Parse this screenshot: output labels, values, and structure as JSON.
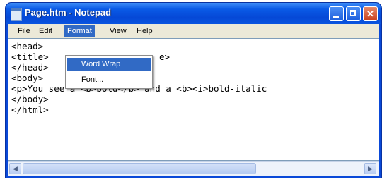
{
  "window": {
    "title": "Page.htm - Notepad"
  },
  "menubar": {
    "file": "File",
    "edit": "Edit",
    "format": "Format",
    "view": "View",
    "help": "Help"
  },
  "format_menu": {
    "word_wrap": "Word Wrap",
    "font": "Font..."
  },
  "editor": {
    "lines": [
      "<head>",
      "<title>",
      "</head>",
      "<body>",
      "<p>You see a <b>bold</b> and a <b><i>bold-italic",
      "</body>",
      "</html>"
    ],
    "line2_tail": "e>"
  },
  "icons": {
    "app": "notepad-icon",
    "minimize": "minimize-icon",
    "maximize": "maximize-icon",
    "close": "close-icon"
  },
  "colors": {
    "titlebar": "#0548d6",
    "menu_highlight": "#316ac5",
    "close_button": "#c9401e"
  }
}
